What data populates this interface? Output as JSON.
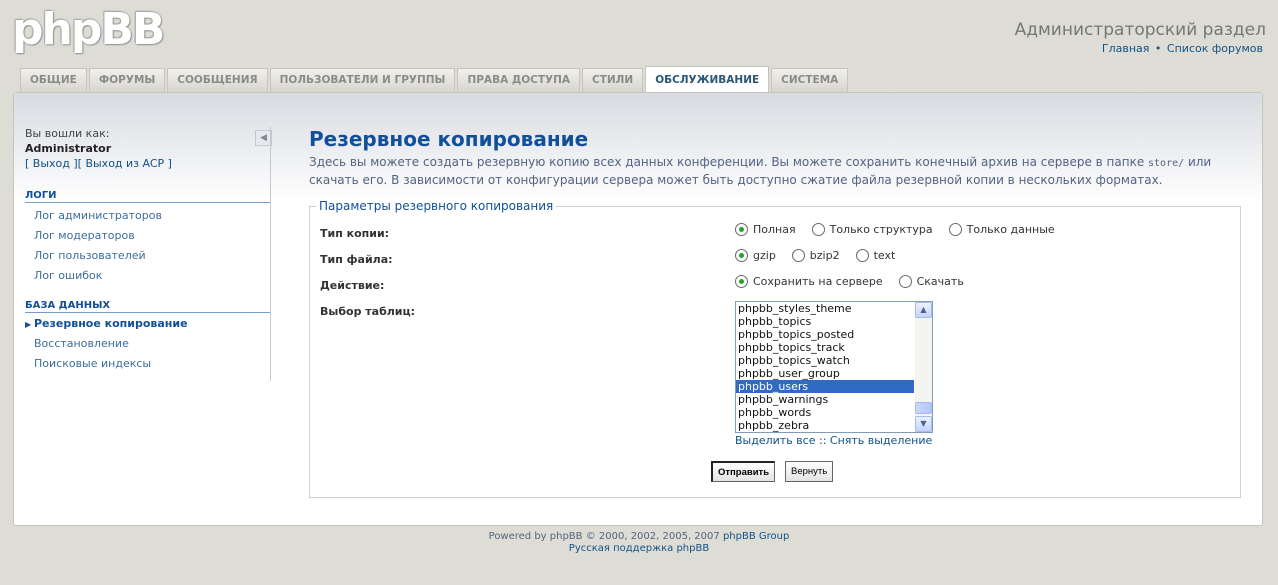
{
  "header": {
    "logo_text": "phpBB",
    "title": "Администраторский раздел",
    "links": [
      "Главная",
      "Список форумов"
    ],
    "separator": "•"
  },
  "tabs": [
    {
      "label": "ОБЩИЕ"
    },
    {
      "label": "ФОРУМЫ"
    },
    {
      "label": "СООБЩЕНИЯ"
    },
    {
      "label": "ПОЛЬЗОВАТЕЛИ И ГРУППЫ"
    },
    {
      "label": "ПРАВА ДОСТУПА"
    },
    {
      "label": "СТИЛИ"
    },
    {
      "label": "ОБСЛУЖИВАНИЕ",
      "active": true
    },
    {
      "label": "СИСТЕМА"
    }
  ],
  "sidebar": {
    "login_label": "Вы вошли как:",
    "username": "Administrator",
    "logout_link": "Выход",
    "acp_logout_link": "Выход из ACP",
    "collapse_icon": "◀",
    "sections": [
      {
        "title": "ЛОГИ",
        "items": [
          {
            "label": "Лог администраторов"
          },
          {
            "label": "Лог модераторов"
          },
          {
            "label": "Лог пользователей"
          },
          {
            "label": "Лог ошибок"
          }
        ]
      },
      {
        "title": "БАЗА ДАННЫХ",
        "items": [
          {
            "label": "Резервное копирование",
            "active": true
          },
          {
            "label": "Восстановление"
          },
          {
            "label": "Поисковые индексы"
          }
        ]
      }
    ]
  },
  "main": {
    "title": "Резервное копирование",
    "desc_part1": "Здесь вы можете создать резервную копию всех данных конференции. Вы можете сохранить конечный архив на сервере в папке ",
    "desc_code": "store/",
    "desc_part2": " или скачать его. В зависимости от конфигурации сервера может быть доступно сжатие файла резервной копии в нескольких форматах.",
    "fieldset_legend": "Параметры резервного копирования",
    "backup_type": {
      "label": "Тип копии:",
      "options": [
        {
          "label": "Полная",
          "checked": true
        },
        {
          "label": "Только структура",
          "checked": false
        },
        {
          "label": "Только данные",
          "checked": false
        }
      ]
    },
    "file_type": {
      "label": "Тип файла:",
      "options": [
        {
          "label": "gzip",
          "checked": true
        },
        {
          "label": "bzip2",
          "checked": false
        },
        {
          "label": "text",
          "checked": false
        }
      ]
    },
    "action": {
      "label": "Действие:",
      "options": [
        {
          "label": "Сохранить на сервере",
          "checked": true
        },
        {
          "label": "Скачать",
          "checked": false
        }
      ]
    },
    "tables": {
      "label": "Выбор таблиц:",
      "visible_options": [
        {
          "label": "phpbb_styles_theme",
          "selected": false
        },
        {
          "label": "phpbb_topics",
          "selected": false
        },
        {
          "label": "phpbb_topics_posted",
          "selected": false
        },
        {
          "label": "phpbb_topics_track",
          "selected": false
        },
        {
          "label": "phpbb_topics_watch",
          "selected": false
        },
        {
          "label": "phpbb_user_group",
          "selected": false
        },
        {
          "label": "phpbb_users",
          "selected": true
        },
        {
          "label": "phpbb_warnings",
          "selected": false
        },
        {
          "label": "phpbb_words",
          "selected": false
        },
        {
          "label": "phpbb_zebra",
          "selected": false
        }
      ],
      "select_all": "Выделить все",
      "select_sep": "::",
      "deselect": "Снять выделение"
    },
    "submit_label": "Отправить",
    "reset_label": "Вернуть"
  },
  "footer": {
    "powered_prefix": "Powered by phpBB © 2000, 2002, 2005, 2007",
    "powered_link": "phpBB Group",
    "support_link": "Русская поддержка phpBB"
  },
  "colors": {
    "background": "#deddd5",
    "accent": "#115098",
    "link": "#105289",
    "selection": "#316ac5",
    "radio_dot": "#2a9f2a"
  }
}
